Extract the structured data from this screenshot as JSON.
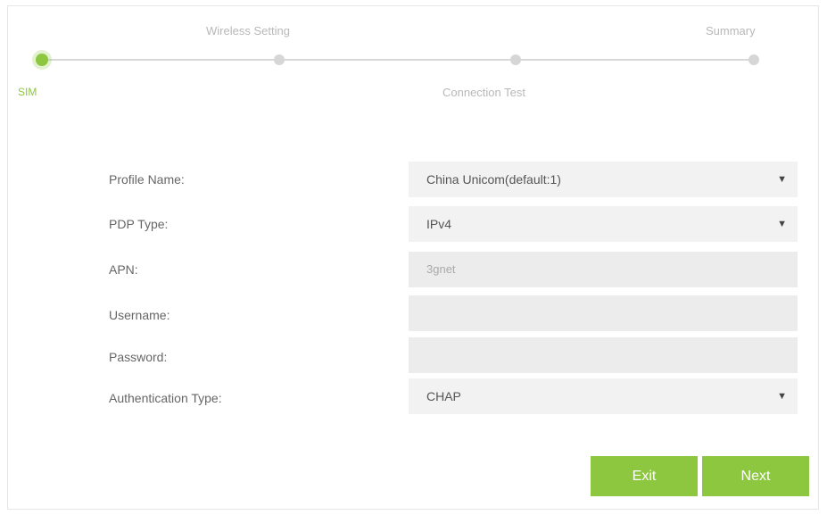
{
  "steps": [
    {
      "label": "SIM",
      "active": true
    },
    {
      "label": "Wireless Setting",
      "active": false
    },
    {
      "label": "Connection Test",
      "active": false
    },
    {
      "label": "Summary",
      "active": false
    }
  ],
  "form": {
    "profile_name": {
      "label": "Profile Name:",
      "value": "China Unicom(default:1)"
    },
    "pdp_type": {
      "label": "PDP Type:",
      "value": "IPv4"
    },
    "apn": {
      "label": "APN:",
      "value": "3gnet"
    },
    "username": {
      "label": "Username:",
      "value": ""
    },
    "password": {
      "label": "Password:",
      "value": ""
    },
    "auth_type": {
      "label": "Authentication Type:",
      "value": "CHAP"
    }
  },
  "buttons": {
    "exit": "Exit",
    "next": "Next"
  },
  "colors": {
    "accent": "#8dc63f",
    "field_bg": "#f2f2f2"
  },
  "icons": {
    "dropdown": "caret-down-icon"
  }
}
